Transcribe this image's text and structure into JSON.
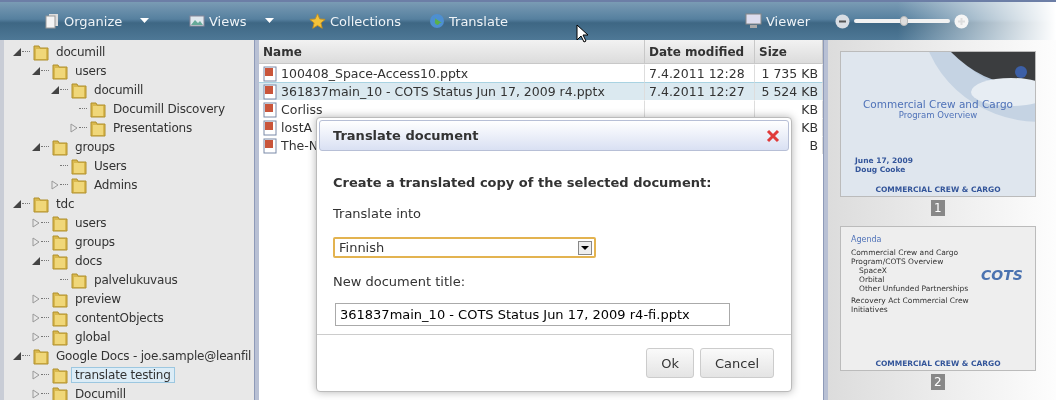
{
  "toolbar": {
    "items": [
      {
        "label": "Organize",
        "kind": "menu"
      },
      {
        "label": "Views",
        "kind": "menu"
      },
      {
        "label": "Collections",
        "kind": "plain"
      },
      {
        "label": "Translate",
        "kind": "plain"
      }
    ],
    "viewer": {
      "label": "Viewer"
    },
    "zoom": {
      "level": 0.52
    }
  },
  "tree": [
    {
      "label": "documill",
      "kind": "branch",
      "expanded": true,
      "selected": false,
      "children": [
        {
          "label": "users",
          "kind": "branch",
          "expanded": true,
          "selected": false,
          "children": [
            {
              "label": "documill",
              "kind": "branch",
              "expanded": true,
              "selected": false,
              "children": [
                {
                  "label": "Documill Discovery",
                  "kind": "leaf",
                  "selected": false
                },
                {
                  "label": "Presentations",
                  "kind": "branch",
                  "expanded": false,
                  "selected": false
                }
              ]
            }
          ]
        },
        {
          "label": "groups",
          "kind": "branch",
          "expanded": true,
          "selected": false,
          "children": [
            {
              "label": "Users",
              "kind": "leaf",
              "selected": false
            },
            {
              "label": "Admins",
              "kind": "branch",
              "expanded": false,
              "selected": false
            }
          ]
        }
      ]
    },
    {
      "label": "tdc",
      "kind": "branch",
      "expanded": true,
      "selected": false,
      "children": [
        {
          "label": "users",
          "kind": "branch",
          "expanded": false,
          "selected": false
        },
        {
          "label": "groups",
          "kind": "branch",
          "expanded": false,
          "selected": false
        },
        {
          "label": "docs",
          "kind": "branch",
          "expanded": true,
          "selected": false,
          "children": [
            {
              "label": "palvelukuvaus",
              "kind": "leaf",
              "selected": false
            }
          ]
        },
        {
          "label": "preview",
          "kind": "branch",
          "expanded": false,
          "selected": false
        },
        {
          "label": "contentObjects",
          "kind": "branch",
          "expanded": false,
          "selected": false
        },
        {
          "label": "global",
          "kind": "branch",
          "expanded": false,
          "selected": false
        }
      ]
    },
    {
      "label": "Google Docs - joe.sample@leanfil",
      "kind": "branch",
      "expanded": true,
      "selected": false,
      "children": [
        {
          "label": "translate testing",
          "kind": "branch",
          "expanded": false,
          "selected": true
        },
        {
          "label": "Documill",
          "kind": "branch",
          "expanded": false,
          "selected": false
        }
      ]
    }
  ],
  "table": {
    "columns": [
      "Name",
      "Date modified",
      "Size"
    ],
    "rows": [
      {
        "name": "100408_Space-Access10.pptx",
        "date": "7.4.2011 12:28",
        "size": "1 735 KB",
        "selected": false
      },
      {
        "name": "361837main_10 - COTS Status Jun 17, 2009 r4.pptx",
        "date": "7.4.2011 12:27",
        "size": "5 524 KB",
        "selected": true
      },
      {
        "name": "Corliss",
        "size": "KB",
        "selected": false
      },
      {
        "name": "lostA",
        "size": "KB",
        "selected": false
      },
      {
        "name": "The-N",
        "size": "B",
        "selected": false
      }
    ]
  },
  "preview": {
    "slides": [
      {
        "kind": "title",
        "title": "Commercial Crew and Cargo",
        "subtitle": "Program Overview",
        "date": "June 17, 2009",
        "author": "Doug Cooke",
        "footer": "COMMERCIAL CREW & CARGO",
        "number": "1"
      },
      {
        "kind": "agenda",
        "title": "Agenda",
        "bullets": [
          {
            "text": "Commercial Crew and Cargo Program/COTS Overview",
            "sub": [
              "SpaceX",
              "Orbital",
              "Other Unfunded Partnerships"
            ]
          },
          {
            "text": "Recovery Act Commercial Crew Initiatives"
          }
        ],
        "logo": "COTS",
        "footer": "COMMERCIAL CREW & CARGO",
        "number": "2"
      }
    ]
  },
  "dialog": {
    "title": "Translate document",
    "heading": "Create a translated copy of the selected document:",
    "language_label": "Translate into",
    "language": "Finnish",
    "title_label": "New document title:",
    "title_value": "361837main_10 - COTS Status Jun 17, 2009 r4-fi.pptx",
    "buttons": [
      "Ok",
      "Cancel"
    ]
  }
}
